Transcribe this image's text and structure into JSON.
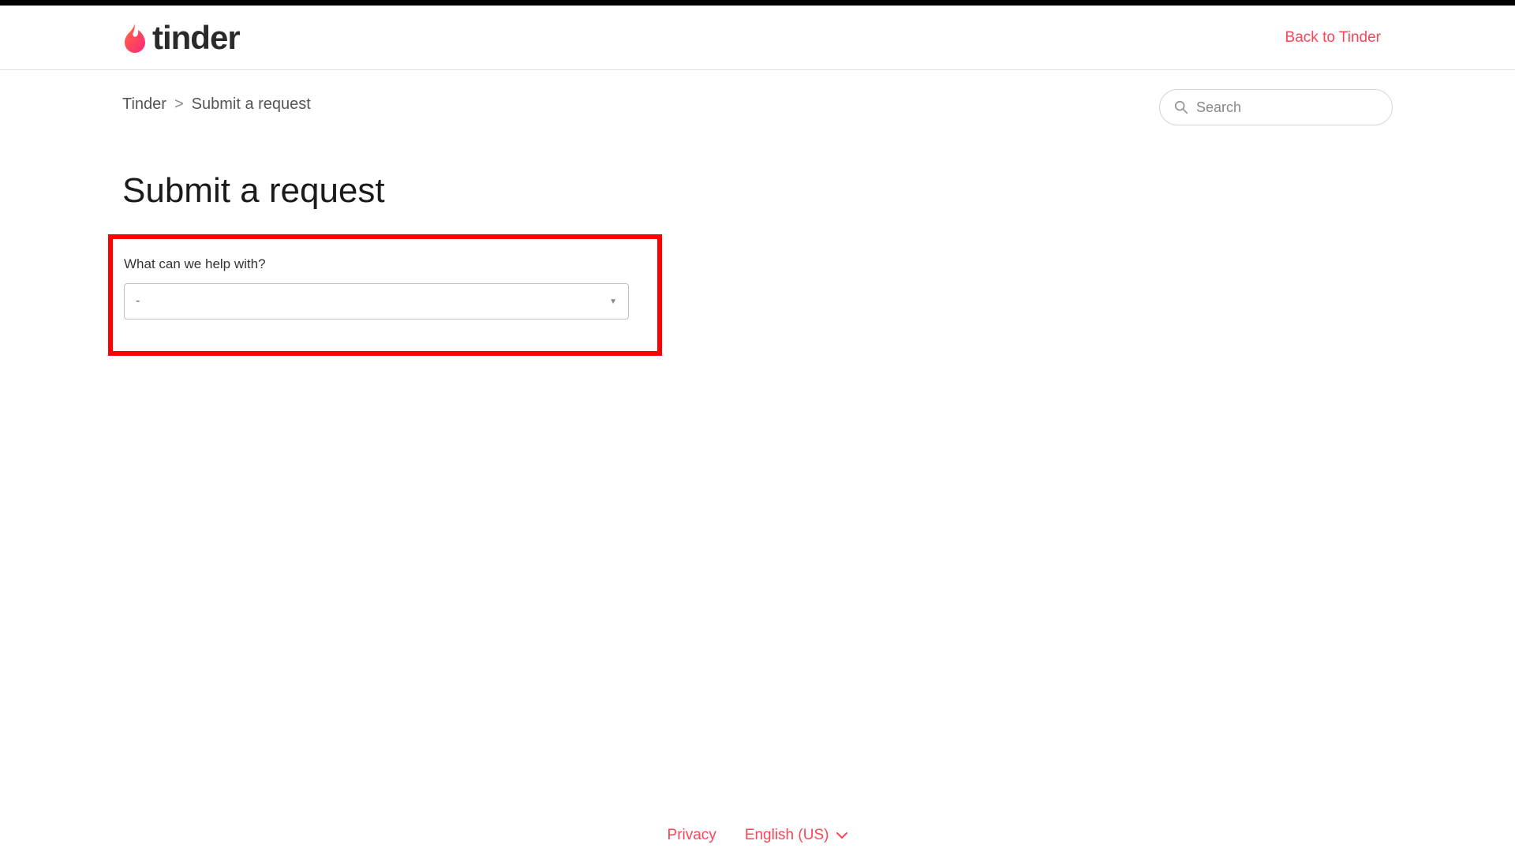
{
  "header": {
    "logo_text": "tinder",
    "back_link": "Back to Tinder"
  },
  "breadcrumb": {
    "root": "Tinder",
    "separator": ">",
    "current": "Submit a request"
  },
  "search": {
    "placeholder": "Search"
  },
  "page": {
    "title": "Submit a request"
  },
  "form": {
    "label": "What can we help with?",
    "dropdown_value": "-"
  },
  "footer": {
    "privacy": "Privacy",
    "language": "English (US)"
  }
}
